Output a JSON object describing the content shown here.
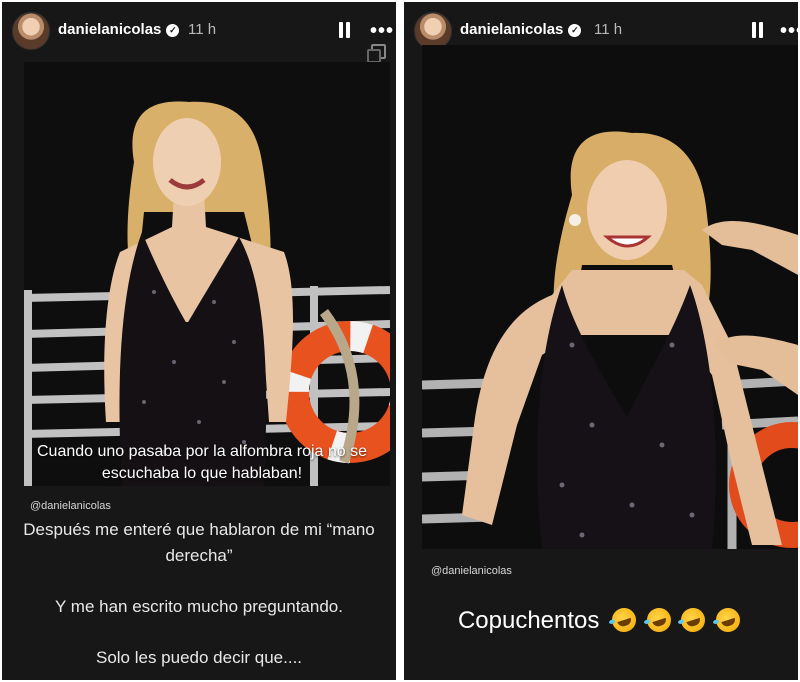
{
  "stories": [
    {
      "header": {
        "username": "danielanicolas",
        "verified_glyph": "✓",
        "time": "11 h",
        "more_glyph": "•••"
      },
      "photo_caption": [
        "Cuando uno pasaba por la alfombra roja no se",
        "escuchaba lo que hablaban!"
      ],
      "mention": "@danielanicolas",
      "lines": [
        "Después me enteré que hablaron de mi “mano",
        "derecha”",
        "Y me han escrito mucho preguntando.",
        "Solo les puedo decir que...."
      ]
    },
    {
      "header": {
        "username": "danielanicolas",
        "verified_glyph": "✓",
        "time": "11 h",
        "more_glyph": "•••"
      },
      "mention": "@danielanicolas",
      "big_text": "Copuchentos",
      "emojis": [
        "rolling-on-floor-laughing-icon",
        "rolling-on-floor-laughing-icon",
        "rolling-on-floor-laughing-icon",
        "rolling-on-floor-laughing-icon"
      ]
    }
  ]
}
